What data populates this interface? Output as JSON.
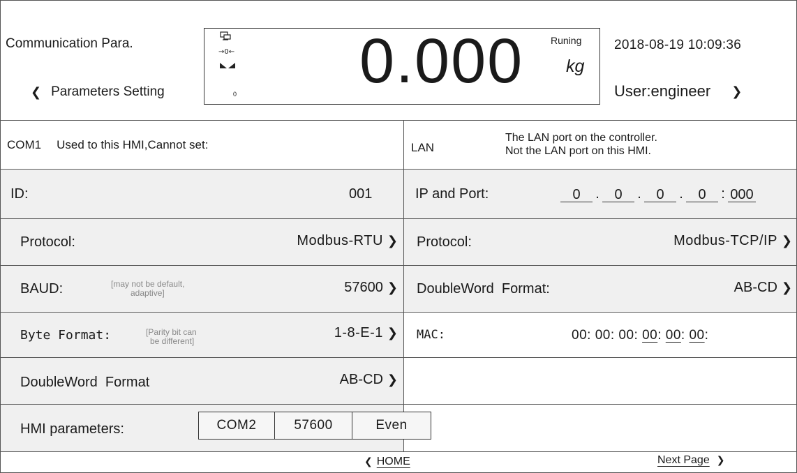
{
  "header": {
    "screen_title": "Communication Para.",
    "back_label": "Parameters Setting",
    "weight_value": "0.000",
    "weight_unit": "kg",
    "status": "Runing",
    "datetime": "2018-08-19 10:09:36",
    "user": "User:engineer",
    "zero_icon_text": "→0←",
    "count_text": "0"
  },
  "com1": {
    "title": "COM1",
    "description": "Used to this HMI,Cannot set:",
    "id_label": "ID:",
    "id_value": "001",
    "protocol_label": "Protocol:",
    "protocol_value": "Modbus-RTU",
    "baud_label": "BAUD:",
    "baud_note_1": "[may  not be default,",
    "baud_note_2": "adaptive]",
    "baud_value": "57600",
    "byte_label": "Byte Format:",
    "byte_note_1": "[Parity bit can",
    "byte_note_2": "be different]",
    "byte_value": "1-8-E-1",
    "dw_label": "DoubleWord  Format",
    "dw_value": "AB-CD",
    "hmi_label": "HMI parameters:",
    "hmi_port": "COM2",
    "hmi_baud": "57600",
    "hmi_parity": "Even"
  },
  "lan": {
    "title": "LAN",
    "description_1": "The LAN port on the controller.",
    "description_2": "Not the LAN port on this HMI.",
    "ip_label": "IP and Port:",
    "ip_1": "0",
    "ip_2": "0",
    "ip_3": "0",
    "ip_4": "0",
    "ip_dot": ".",
    "ip_colon": ":",
    "port": "000",
    "protocol_label": "Protocol:",
    "protocol_value": "Modbus-TCP/IP",
    "dw_label": "DoubleWord  Format:",
    "dw_value": "AB-CD",
    "mac_label": "MAC:",
    "mac_value_plain": "00: 00: 00: ",
    "mac_u1": "00",
    "mac_u2": "00",
    "mac_u3": "00",
    "mac_sep": ":"
  },
  "footer": {
    "home_label": "HOME",
    "next_label": "Next Page"
  },
  "icons": {
    "chevron_left": "❮",
    "chevron_right": "❯"
  },
  "colors": {
    "row_background": "#f0f0f0",
    "border": "#555555",
    "text": "#1a1a1a",
    "note": "#888888"
  }
}
